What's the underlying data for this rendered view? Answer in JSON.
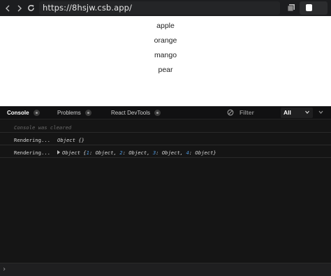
{
  "browser": {
    "url": "https://8hsjw.csb.app/"
  },
  "preview": {
    "items": [
      "apple",
      "orange",
      "mango",
      "pear"
    ]
  },
  "devtools": {
    "tabs": [
      "Console",
      "Problems",
      "React DevTools"
    ],
    "filter_placeholder": "Filter",
    "level": "All",
    "console": {
      "cleared_message": "Console was cleared",
      "line1_label": "Rendering...",
      "line1_value": "Object {}",
      "line2_label": "Rendering...",
      "line2_prefix": "Object {",
      "line2_entries": [
        {
          "key": "1",
          "value": " Object"
        },
        {
          "key": "2",
          "value": " Object"
        },
        {
          "key": "3",
          "value": " Object"
        },
        {
          "key": "4",
          "value": " Object"
        }
      ],
      "line2_suffix": "}"
    },
    "prompt": "›"
  },
  "colors": {
    "accent_key": "#4f9ae0",
    "preview_bg": "#ffffff",
    "devtools_bg": "#151515"
  },
  "icons": [
    "back-arrow-icon",
    "forward-arrow-icon",
    "refresh-icon",
    "copy-icon",
    "clear-console-icon",
    "chevron-down-icon"
  ]
}
